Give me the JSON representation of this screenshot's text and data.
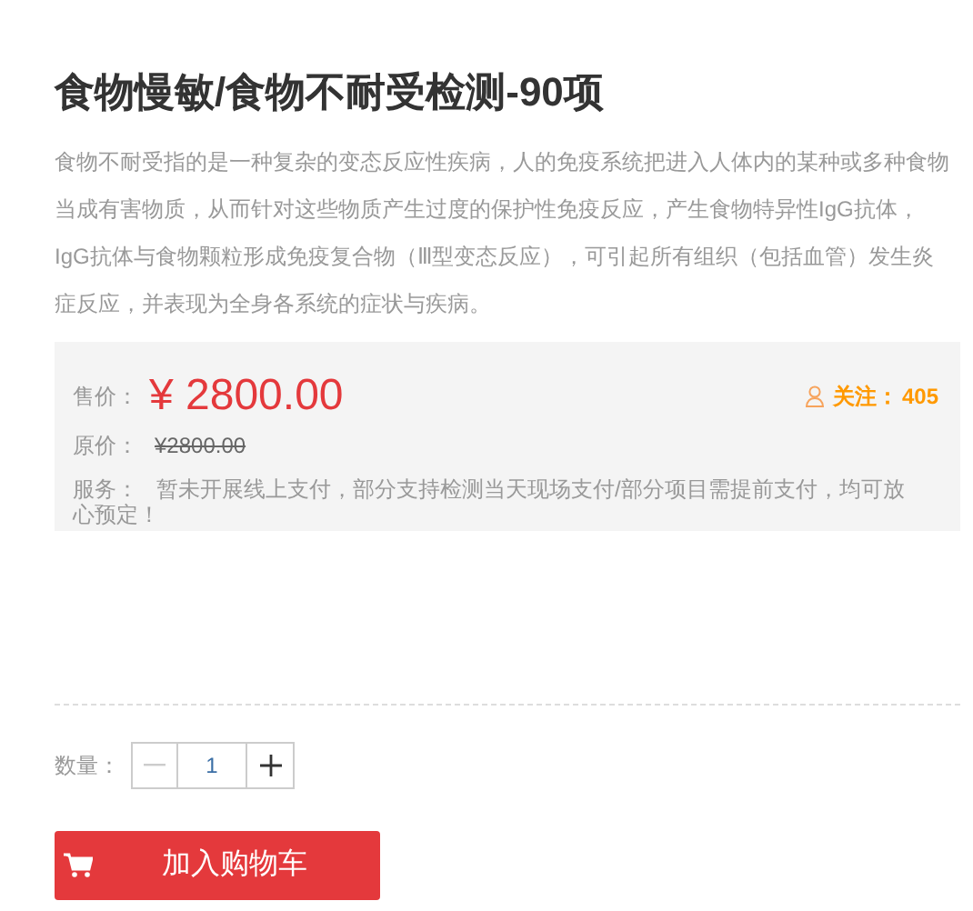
{
  "title": "食物慢敏/食物不耐受检测-90项",
  "description": "食物不耐受指的是一种复杂的变态反应性疾病，人的免疫系统把进入人体内的某种或多种食物当成有害物质，从而针对这些物质产生过度的保护性免疫反应，产生食物特异性IgG抗体，IgG抗体与食物颗粒形成免疫复合物（Ⅲ型变态反应），可引起所有组织（包括血管）发生炎症反应，并表现为全身各系统的症状与疾病。",
  "price": {
    "label": "售价：",
    "value": "¥ 2800.00"
  },
  "follow": {
    "label": "关注：",
    "count": "405"
  },
  "original_price": {
    "label": "原价：",
    "value": "¥2800.00"
  },
  "service": {
    "label": "服务：",
    "text": "暂未开展线上支付，部分支持检测当天现场支付/部分项目需提前支付，均可放心预定！"
  },
  "quantity": {
    "label": "数量：",
    "value": "1",
    "decrement_disabled": true
  },
  "add_to_cart": {
    "label": "加入购物车"
  }
}
